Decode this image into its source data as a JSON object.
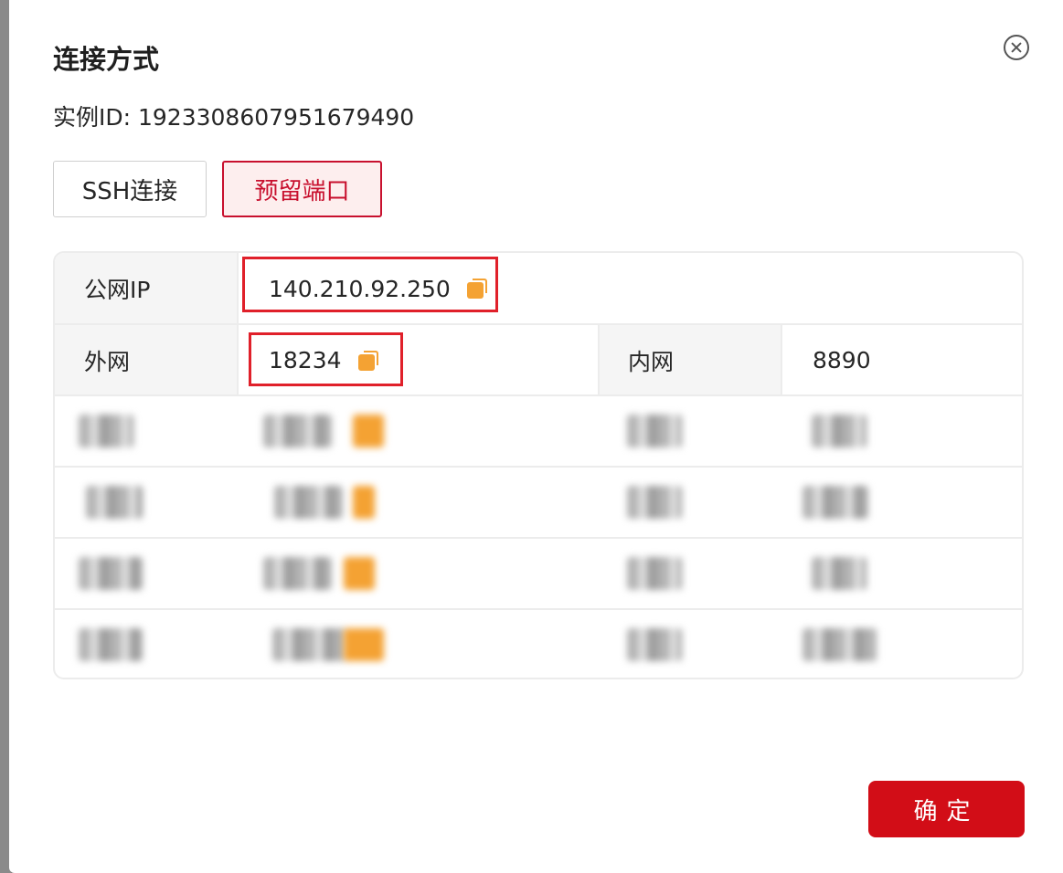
{
  "dialog": {
    "title": "连接方式",
    "instance_id_text": "实例ID: 1923308607951679490"
  },
  "tabs": [
    {
      "label": "SSH连接",
      "active": false
    },
    {
      "label": "预留端口",
      "active": true
    }
  ],
  "table": {
    "public_ip_label": "公网IP",
    "public_ip_value": "140.210.92.250",
    "external_label": "外网",
    "external_value": "18234",
    "internal_label": "内网",
    "internal_value": "8890"
  },
  "footer": {
    "confirm_label": "确定"
  },
  "colors": {
    "accent": "#d20d17",
    "copy_icon": "#f4a233",
    "highlight_box": "#e0202a"
  }
}
